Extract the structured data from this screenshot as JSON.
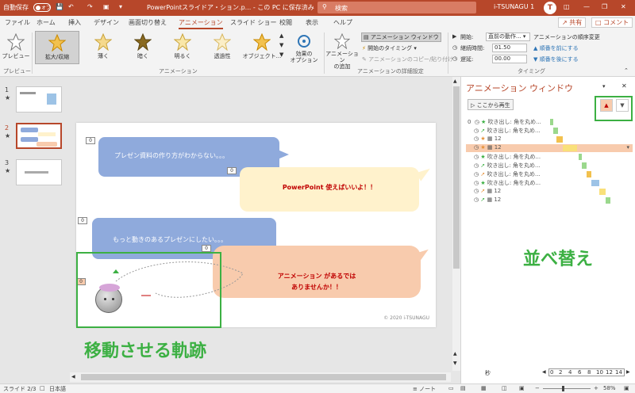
{
  "titlebar": {
    "autosave": "自動保存",
    "autosave_state": "オフ",
    "document_title": "PowerPointスライドア・ション.p... - この PC に保存済み",
    "search_placeholder": "検索",
    "user_name": "i-TSUNAGU 1",
    "avatar_initial": "T"
  },
  "tabs": [
    "ファイル",
    "ホーム",
    "挿入",
    "デザイン",
    "画面切り替え",
    "アニメーション",
    "スライド ショー",
    "校閲",
    "表示",
    "ヘルプ"
  ],
  "active_tab": "アニメーション",
  "share_label": "共有",
  "comment_label": "コメント",
  "ribbon": {
    "preview": "プレビュー",
    "preview_group": "プレビュー",
    "gallery": [
      "拡大/収縮",
      "薄く",
      "暗く",
      "明るく",
      "透過性",
      "オブジェクト..."
    ],
    "effect_options": "効果の\nオプション",
    "animation_group": "アニメーション",
    "add_animation": "アニメーション\nの追加",
    "animation_window": "アニメーション ウィンドウ",
    "trigger": "開始のタイミング",
    "animation_painter": "アニメーションのコピー/貼り付け",
    "advanced_group": "アニメーションの詳細設定",
    "start_label": "開始:",
    "start_value": "直前の動作...",
    "duration_label": "継続時間:",
    "duration_value": "01.50",
    "delay_label": "遅延:",
    "delay_value": "00.00",
    "reorder_label": "アニメーションの順序変更",
    "move_earlier": "順番を前にする",
    "move_later": "順番を後にする",
    "timing_group": "タイミング"
  },
  "slides": [
    {
      "number": "1",
      "star": "★"
    },
    {
      "number": "2",
      "star": "★"
    },
    {
      "number": "3",
      "star": "★"
    }
  ],
  "slide": {
    "bubble1": "プレゼン資料の作り方がわからない。。。",
    "bubble2": "PowerPoint 使えばいいよ！！",
    "bubble3": "もっと動きのあるプレゼンにしたい。。。",
    "bubble4": "アニメーション があるでは\nありませんか！！",
    "copyright": "© 2020 i-TSUNAGU",
    "tag_labels": [
      "0",
      "0",
      "0",
      "0",
      "0"
    ]
  },
  "annotations": {
    "trajectory": "移動させる軌跡",
    "reorder": "並べ替え"
  },
  "anipane": {
    "title": "アニメーション ウィンドウ",
    "play_from": "ここから再生",
    "rows": [
      {
        "num": "0",
        "label": "吹き出し: 角を丸め..."
      },
      {
        "num": "",
        "label": "吹き出し: 角を丸め..."
      },
      {
        "num": "",
        "label": "12"
      },
      {
        "num": "",
        "label": "12"
      },
      {
        "num": "",
        "label": "吹き出し: 角を丸め..."
      },
      {
        "num": "",
        "label": "吹き出し: 角を丸め..."
      },
      {
        "num": "",
        "label": "吹き出し: 角を丸め..."
      },
      {
        "num": "",
        "label": "吹き出し: 角を丸め..."
      },
      {
        "num": "",
        "label": "12"
      },
      {
        "num": "",
        "label": "12"
      }
    ],
    "seconds_label": "秒",
    "timeline_ticks": [
      "0",
      "2",
      "4",
      "6",
      "8",
      "10",
      "12",
      "14"
    ]
  },
  "statusbar": {
    "slide_info": "スライド 2/3",
    "language": "日本語",
    "notes": "ノート",
    "zoom": "58%"
  },
  "colors": {
    "accent": "#b7472a",
    "green_annotation": "#3cb043",
    "bubble_blue": "#8faadc",
    "bubble_yellow": "#fff2cc",
    "bubble_orange": "#f8cbad"
  }
}
